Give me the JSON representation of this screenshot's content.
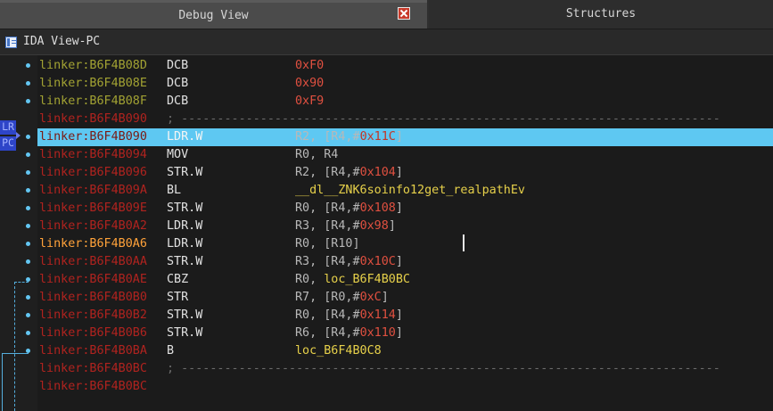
{
  "tabs": {
    "debug_view": "Debug View",
    "structures": "Structures"
  },
  "view_title": "IDA View-PC",
  "badges": {
    "lr": "LR",
    "pc": "PC"
  },
  "rows": [
    {
      "addr": "linker:B6F4B08D",
      "instr": "DCB",
      "ops": [
        {
          "t": "0xF0",
          "c": "hex"
        }
      ],
      "addr_color": "olive"
    },
    {
      "addr": "linker:B6F4B08E",
      "instr": "DCB",
      "ops": [
        {
          "t": "0x90",
          "c": "hex"
        }
      ],
      "addr_color": "olive"
    },
    {
      "addr": "linker:B6F4B08F",
      "instr": "DCB",
      "ops": [
        {
          "t": "0xF9",
          "c": "hex"
        }
      ],
      "addr_color": "olive"
    },
    {
      "addr": "linker:B6F4B090",
      "sep": "; ---------------------------------------------------------------------------",
      "addr_color": "red"
    },
    {
      "addr": "linker:B6F4B090",
      "instr": "LDR.W",
      "ops": [
        {
          "t": "R2, [R4,#",
          "c": "op"
        },
        {
          "t": "0x11C",
          "c": "hex"
        },
        {
          "t": "]",
          "c": "op"
        }
      ],
      "addr_color": "red",
      "selected": true
    },
    {
      "addr": "linker:B6F4B094",
      "instr": "MOV",
      "ops": [
        {
          "t": "R0, R4",
          "c": "op"
        }
      ],
      "addr_color": "red"
    },
    {
      "addr": "linker:B6F4B096",
      "instr": "STR.W",
      "ops": [
        {
          "t": "R2, [R4,#",
          "c": "op"
        },
        {
          "t": "0x104",
          "c": "hex"
        },
        {
          "t": "]",
          "c": "op"
        }
      ],
      "addr_color": "red"
    },
    {
      "addr": "linker:B6F4B09A",
      "instr": "BL",
      "ops": [
        {
          "t": "__dl__ZNK6soinfo12get_realpathEv",
          "c": "sym"
        }
      ],
      "addr_color": "red"
    },
    {
      "addr": "linker:B6F4B09E",
      "instr": "STR.W",
      "ops": [
        {
          "t": "R0, [R4,#",
          "c": "op"
        },
        {
          "t": "0x108",
          "c": "hex"
        },
        {
          "t": "]",
          "c": "op"
        }
      ],
      "addr_color": "red"
    },
    {
      "addr": "linker:B6F4B0A2",
      "instr": "LDR.W",
      "ops": [
        {
          "t": "R3, [R4,#",
          "c": "op"
        },
        {
          "t": "0x98",
          "c": "hex"
        },
        {
          "t": "]",
          "c": "op"
        }
      ],
      "addr_color": "red"
    },
    {
      "addr": "linker:B6F4B0A6",
      "instr": "LDR.W",
      "ops": [
        {
          "t": "R0, [R10]",
          "c": "op"
        }
      ],
      "addr_color": "orange"
    },
    {
      "addr": "linker:B6F4B0AA",
      "instr": "STR.W",
      "ops": [
        {
          "t": "R3, [R4,#",
          "c": "op"
        },
        {
          "t": "0x10C",
          "c": "hex"
        },
        {
          "t": "]",
          "c": "op"
        }
      ],
      "addr_color": "red"
    },
    {
      "addr": "linker:B6F4B0AE",
      "instr": "CBZ",
      "ops": [
        {
          "t": "R0, ",
          "c": "op"
        },
        {
          "t": "loc_B6F4B0BC",
          "c": "sym"
        }
      ],
      "addr_color": "red"
    },
    {
      "addr": "linker:B6F4B0B0",
      "instr": "STR",
      "ops": [
        {
          "t": "R7, [R0,#",
          "c": "op"
        },
        {
          "t": "0xC",
          "c": "hex"
        },
        {
          "t": "]",
          "c": "op"
        }
      ],
      "addr_color": "red"
    },
    {
      "addr": "linker:B6F4B0B2",
      "instr": "STR.W",
      "ops": [
        {
          "t": "R0, [R4,#",
          "c": "op"
        },
        {
          "t": "0x114",
          "c": "hex"
        },
        {
          "t": "]",
          "c": "op"
        }
      ],
      "addr_color": "red"
    },
    {
      "addr": "linker:B6F4B0B6",
      "instr": "STR.W",
      "ops": [
        {
          "t": "R6, [R4,#",
          "c": "op"
        },
        {
          "t": "0x110",
          "c": "hex"
        },
        {
          "t": "]",
          "c": "op"
        }
      ],
      "addr_color": "red"
    },
    {
      "addr": "linker:B6F4B0BA",
      "instr": "B",
      "ops": [
        {
          "t": "loc_B6F4B0C8",
          "c": "sym"
        }
      ],
      "addr_color": "red"
    },
    {
      "addr": "linker:B6F4B0BC",
      "sep": "; ---------------------------------------------------------------------------",
      "addr_color": "red"
    },
    {
      "addr": "linker:B6F4B0BC",
      "addr_color": "red"
    }
  ]
}
